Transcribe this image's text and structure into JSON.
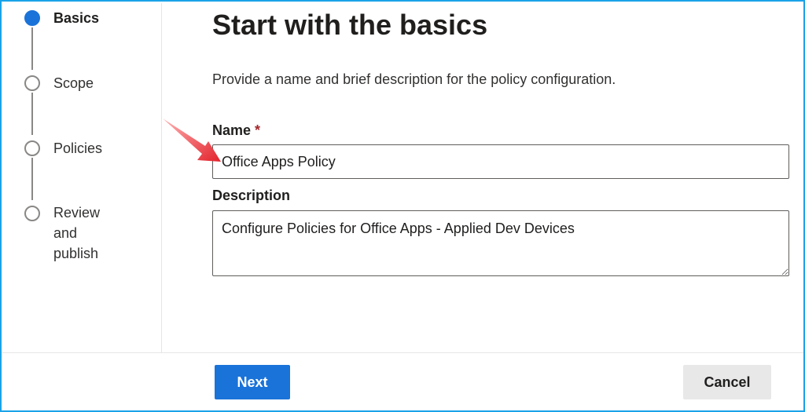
{
  "wizard": {
    "steps": [
      {
        "label": "Basics",
        "active": true
      },
      {
        "label": "Scope",
        "active": false
      },
      {
        "label": "Policies",
        "active": false
      },
      {
        "label": "Review\nand\npublish",
        "active": false
      }
    ]
  },
  "main": {
    "title": "Start with the basics",
    "intro": "Provide a name and brief description for the policy configuration.",
    "name_label": "Name",
    "required_mark": "*",
    "name_value": "Office Apps Policy",
    "description_label": "Description",
    "description_value": "Configure Policies for Office Apps - Applied Dev Devices"
  },
  "footer": {
    "next_label": "Next",
    "cancel_label": "Cancel"
  },
  "colors": {
    "accent": "#1a73d9",
    "frame_border": "#1aa3e8",
    "annotation_arrow": "#e3222b",
    "required": "#a4262c"
  }
}
